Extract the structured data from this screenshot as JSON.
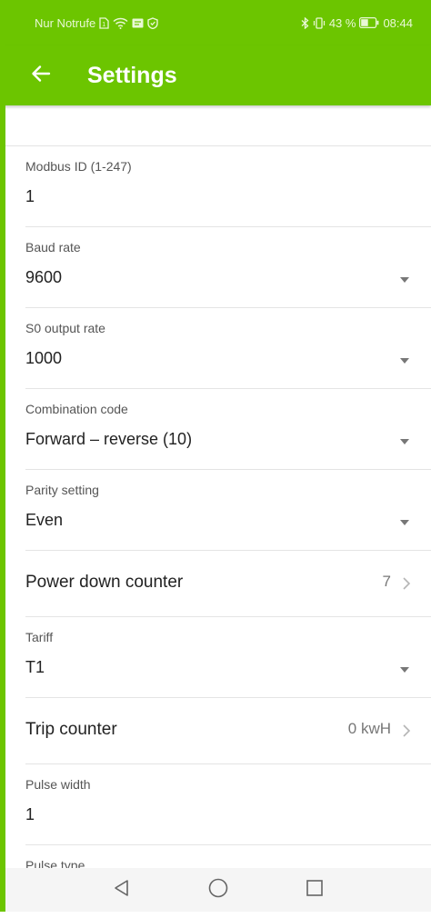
{
  "status_bar": {
    "carrier": "Nur Notrufe",
    "battery_percent": "43 %",
    "time": "08:44"
  },
  "app_bar": {
    "title": "Settings"
  },
  "settings": [
    {
      "label": "Modbus ID (1-247)",
      "value": "1"
    },
    {
      "label": "Baud rate",
      "value": "9600"
    },
    {
      "label": "S0 output rate",
      "value": "1000"
    },
    {
      "label": "Combination code",
      "value": "Forward – reverse (10)"
    },
    {
      "label": "Parity setting",
      "value": "Even"
    },
    {
      "title": "Power down counter",
      "value": "7"
    },
    {
      "label": "Tariff",
      "value": "T1"
    },
    {
      "title": "Trip counter",
      "value": "0 kwH"
    },
    {
      "label": "Pulse width",
      "value": "1"
    },
    {
      "label": "Pulse type"
    }
  ],
  "colors": {
    "primary": "#6cc500",
    "divider": "#e4e4e4",
    "label": "#555555",
    "value": "#222222"
  },
  "icons": {
    "back": "arrow-left-icon",
    "dropdown": "caret-down-icon",
    "navigate": "chevron-right-icon",
    "nav_back": "triangle-back-icon",
    "nav_home": "circle-home-icon",
    "nav_recents": "square-recents-icon"
  }
}
